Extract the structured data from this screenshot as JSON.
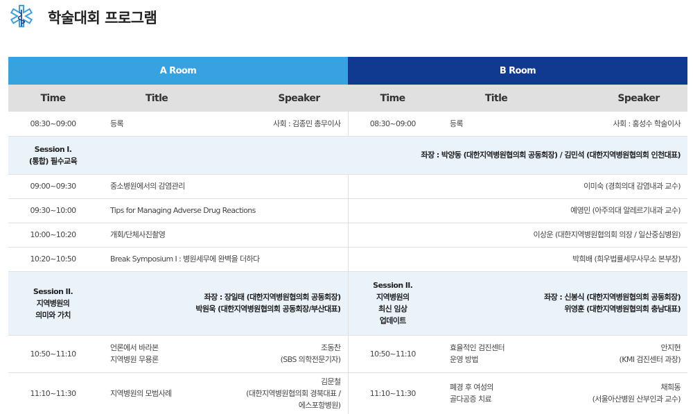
{
  "header": {
    "title": "학술대회 프로그램",
    "logo_icon": "medical-star-of-life-icon"
  },
  "rooms": {
    "a": "A Room",
    "b": "B Room"
  },
  "columns": {
    "time": "Time",
    "title": "Title",
    "speaker": "Speaker"
  },
  "rows": {
    "registration": {
      "a_time": "08:30~09:00",
      "a_title": "등록",
      "a_speaker": "사회 : 김종민 총무이사",
      "b_time": "08:30~09:00",
      "b_title": "등록",
      "b_speaker": "사회 : 홍성수 학술이사"
    },
    "session1": {
      "label": [
        "Session I.",
        "(통합) 필수교육"
      ],
      "chair": "좌장 : 박양동 (대한지역병원협의회 공동회장) / 김민석 (대한지역병원협의회 인천대표)"
    },
    "talks": [
      {
        "time": "09:00~09:30",
        "title": "중소병원에서의 감염관리",
        "speaker": "이미숙 (경희의대 감염내과 교수)"
      },
      {
        "time": "09:30~10:00",
        "title": "Tips for Managing Adverse Drug Reactions",
        "speaker": "예영민 (아주의대 알레르기내과 교수)"
      },
      {
        "time": "10:00~10:20",
        "title": "개회/단체사진촬영",
        "speaker": "이상운 (대한지역병원협의회 의장 / 일산중심병원)"
      },
      {
        "time": "10:20~10:50",
        "title": "Break Symposium I : 병원세무에 완벽을 더하다",
        "speaker": "박희배 (희우법률세무사무소 본부장)"
      }
    ],
    "session2": {
      "a_label": [
        "Session II.",
        "지역병원의",
        "의미와 가치"
      ],
      "a_chair": [
        "좌장 : 장일태 (대한지역병원협의회 공동회장)",
        "박원욱 (대한지역병원협의회 공동회장/부산대표)"
      ],
      "b_label": [
        "Session II.",
        "지역병원의",
        "최신 임상",
        "업데이트"
      ],
      "b_chair": [
        "좌장 : 신봉식 (대한지역병원협의회 공동회장)",
        "위영훈 (대한지역병원협의회 충남대표)"
      ]
    },
    "split1": {
      "a_time": "10:50~11:10",
      "a_title": [
        "언론에서 바라본",
        "지역병원 무용론"
      ],
      "a_speaker": [
        "조동찬",
        "(SBS 의학전문기자)"
      ],
      "b_time": "10:50~11:10",
      "b_title": [
        "효율적인 검진센터",
        "운영 방법"
      ],
      "b_speaker": [
        "안지현",
        "(KMI 검진센터 과장)"
      ]
    },
    "split2": {
      "a_time": "11:10~11:30",
      "a_title": "지역병원의 모범사례",
      "a_speaker": [
        "김문철",
        "(대한지역병원협의회 경북대표 /",
        "에스포항병원)"
      ],
      "b_time": "11:10~11:30",
      "b_title": [
        "폐경 후 여성의",
        "골다공증 치료"
      ],
      "b_speaker": [
        "채희동",
        "(서울아산병원 산부인과 교수)"
      ]
    }
  }
}
